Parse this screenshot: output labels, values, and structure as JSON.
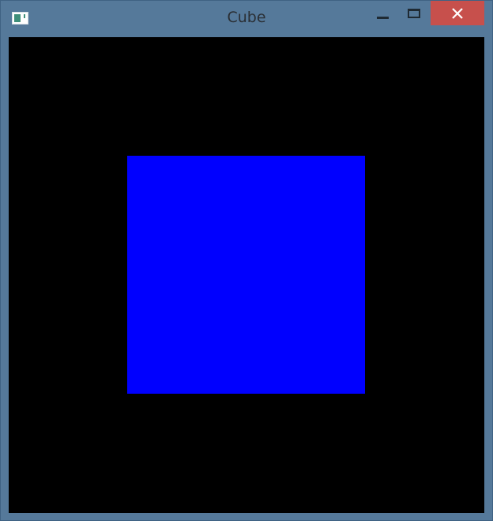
{
  "window": {
    "title": "Cube",
    "controls": {
      "minimize": "minimize",
      "maximize": "maximize",
      "close": "close"
    }
  },
  "viewport": {
    "background_color": "#000000",
    "cube_color": "#0000ff"
  },
  "colors": {
    "frame": "#55799a",
    "close_button": "#c7504c"
  }
}
